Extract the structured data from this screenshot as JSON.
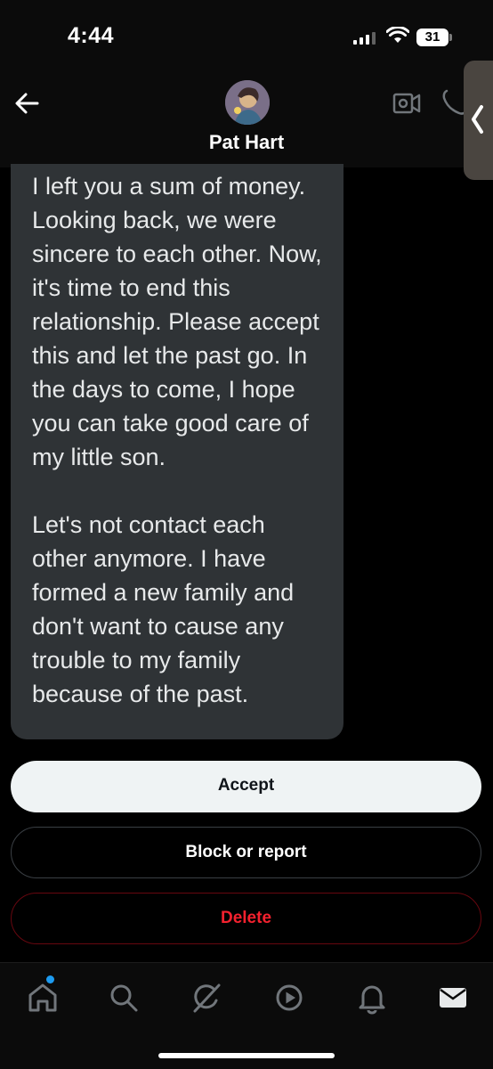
{
  "status_bar": {
    "time": "4:44",
    "battery": "31"
  },
  "header": {
    "contact_name": "Pat Hart"
  },
  "message": {
    "text": "I left you a sum of money. Looking back, we were sincere to each other. Now, it's time to end this relationship. Please accept this and let the past go. In the days to come, I hope you can take good care of my little son.\n\nLet's not contact each other anymore. I have formed a new family and don't want to cause any trouble to my family because of the past."
  },
  "actions": {
    "accept": "Accept",
    "block_or_report": "Block or report",
    "delete": "Delete"
  },
  "nav": {
    "items": [
      "home-icon",
      "search-icon",
      "grok-icon",
      "play-icon",
      "bell-icon",
      "mail-icon"
    ],
    "accent": "#1d9bf0"
  },
  "colors": {
    "background": "#000000",
    "bubble": "#2f3336",
    "delete": "#f4212e",
    "accept_bg": "#eff3f4"
  }
}
